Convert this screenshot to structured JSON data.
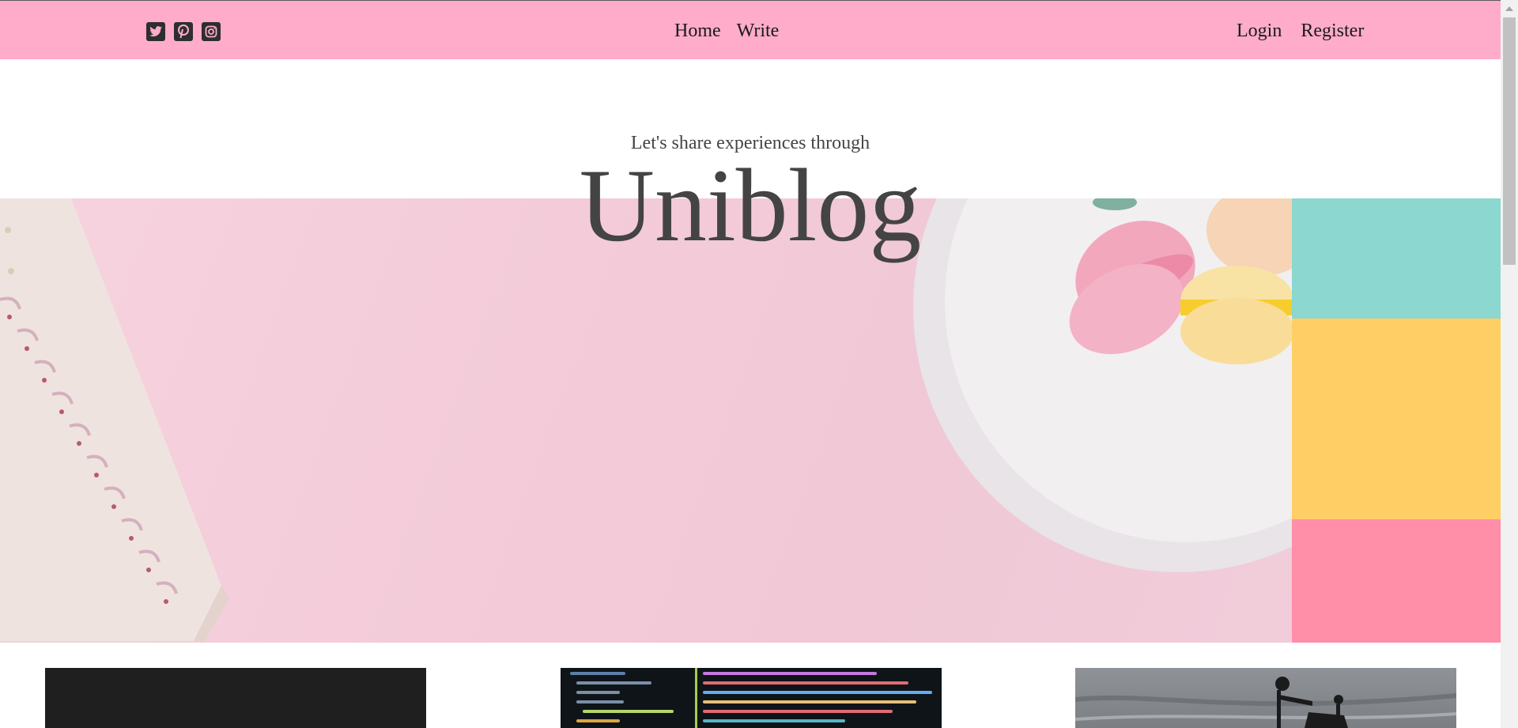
{
  "nav": {
    "links": [
      {
        "label": "Home"
      },
      {
        "label": "Write"
      }
    ],
    "auth": [
      {
        "label": "Login"
      },
      {
        "label": "Register"
      }
    ],
    "social_icons": [
      "twitter-icon",
      "pinterest-icon",
      "instagram-icon"
    ]
  },
  "hero": {
    "subtitle": "Let's share experiences through",
    "title": "Uniblog"
  },
  "colors": {
    "navbar": "#ffacca",
    "hero_bg": "#f3cbd9",
    "teal": "#8cd7cf",
    "yellow": "#ffcf66",
    "pink": "#ff8ea9",
    "text": "#444444"
  }
}
